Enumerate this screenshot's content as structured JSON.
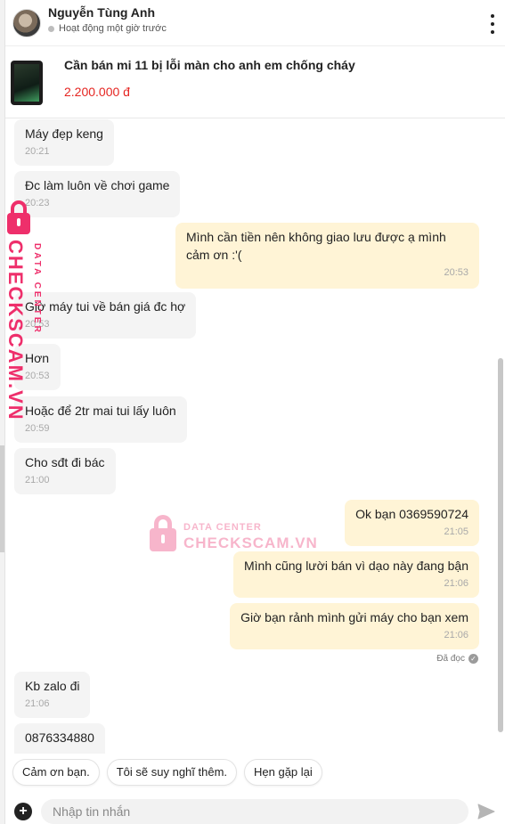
{
  "header": {
    "name": "Nguyễn Tùng Anh",
    "status": "Hoạt động một giờ trước"
  },
  "product": {
    "title": "Cần bán mi 11 bị lỗi màn cho anh em chống cháy",
    "price": "2.200.000 đ"
  },
  "messages": [
    {
      "dir": "in",
      "text": "Máy đẹp keng",
      "time": "20:21"
    },
    {
      "dir": "in",
      "text": "Đc làm luôn về chơi game",
      "time": "20:23"
    },
    {
      "dir": "out",
      "text": "Mình cần tiền nên không giao lưu được ạ mình cảm ơn :'(",
      "time": "20:53"
    },
    {
      "dir": "in",
      "text": "Giờ máy tui về bán giá đc hợ",
      "time": "20:53"
    },
    {
      "dir": "in",
      "text": "Hơn",
      "time": "20:53"
    },
    {
      "dir": "in",
      "text": "Hoặc để 2tr mai tui lấy luôn",
      "time": "20:59"
    },
    {
      "dir": "in",
      "text": "Cho sđt đi bác",
      "time": "21:00"
    },
    {
      "dir": "out",
      "text": "Ok bạn 0369590724",
      "time": "21:05"
    },
    {
      "dir": "out",
      "text": "Mình cũng lười bán vì dạo này đang bận",
      "time": "21:06"
    },
    {
      "dir": "out",
      "text": "Giờ bạn rảnh mình gửi máy cho bạn xem",
      "time": "21:06"
    },
    {
      "dir": "in",
      "text": "Kb zalo đi",
      "time": "21:06"
    },
    {
      "dir": "in",
      "text": "0876334880",
      "time": ""
    }
  ],
  "read_receipt": "Đã đọc",
  "quick_replies": [
    "Cảm ơn bạn.",
    "Tôi sẽ suy nghĩ thêm.",
    "Hẹn gặp lại"
  ],
  "composer": {
    "placeholder": "Nhập tin nhắn"
  },
  "watermark": {
    "brand": "CHECKSCAM.VN",
    "tagline": "DATA CENTER"
  },
  "colors": {
    "accent_price": "#e52521",
    "outgoing_bubble": "#fff4d6",
    "incoming_bubble": "#f4f4f4",
    "watermark": "#ee2f6b"
  },
  "icons": {
    "menu": "more-vertical-icon",
    "add": "plus-circle-icon",
    "send": "send-icon",
    "read": "check-circle-icon"
  }
}
